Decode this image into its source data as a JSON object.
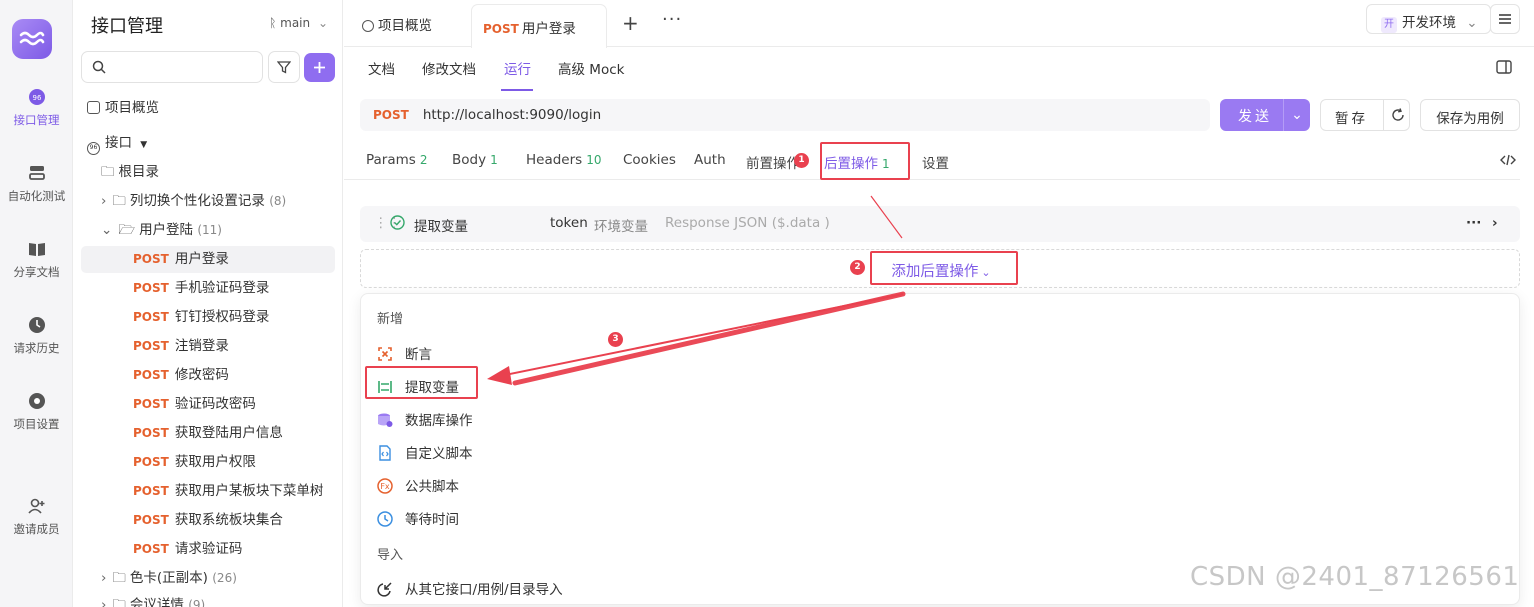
{
  "rail": {
    "items": [
      {
        "label": "接口管理",
        "icon": "api-icon"
      },
      {
        "label": "自动化测试",
        "icon": "automation-icon"
      },
      {
        "label": "分享文档",
        "icon": "book-icon"
      },
      {
        "label": "请求历史",
        "icon": "clock-icon"
      },
      {
        "label": "项目设置",
        "icon": "settings-icon"
      },
      {
        "label": "邀请成员",
        "icon": "invite-user-icon"
      }
    ]
  },
  "tree": {
    "title": "接口管理",
    "branch": "main",
    "search_placeholder": "",
    "overview": "项目概览",
    "api_root": "接口",
    "root_dir": "根目录",
    "folders": [
      {
        "name": "列切换个性化设置记录",
        "count": "(8)"
      },
      {
        "name": "用户登陆",
        "count": "(11)"
      },
      {
        "name": "色卡(正副本)",
        "count": "(26)"
      },
      {
        "name": "会议详情",
        "count": "(9)"
      }
    ],
    "method": "POST",
    "endpoints": [
      "用户登录",
      "手机验证码登录",
      "钉钉授权码登录",
      "注销登录",
      "修改密码",
      "验证码改密码",
      "获取登陆用户信息",
      "获取用户权限",
      "获取用户某板块下菜单树",
      "获取系统板块集合",
      "请求验证码"
    ]
  },
  "topbar": {
    "tab_overview": "项目概览",
    "tab_active_method": "POST",
    "tab_active_name": "用户登录",
    "env_badge": "开",
    "env_name": "开发环境"
  },
  "subtabs": [
    "文档",
    "修改文档",
    "运行",
    "高级 Mock"
  ],
  "request": {
    "method": "POST",
    "url": "http://localhost:9090/login",
    "send": "发送",
    "save": "暂存",
    "save_as": "保存为用例"
  },
  "reqtabs": [
    {
      "label": "Params",
      "count": "2"
    },
    {
      "label": "Body",
      "count": "1"
    },
    {
      "label": "Headers",
      "count": "10"
    },
    {
      "label": "Cookies",
      "count": ""
    },
    {
      "label": "Auth",
      "count": ""
    },
    {
      "label": "前置操作",
      "count": ""
    },
    {
      "label": "后置操作",
      "count": "1"
    },
    {
      "label": "设置",
      "count": ""
    }
  ],
  "extract_row": {
    "name": "提取变量",
    "var": "token",
    "scope": "环境变量",
    "source": "Response JSON ($.data )"
  },
  "add_post_action": "添加后置操作",
  "menu": {
    "new_header": "新增",
    "items": [
      "断言",
      "提取变量",
      "数据库操作",
      "自定义脚本",
      "公共脚本",
      "等待时间"
    ],
    "import_header": "导入",
    "import_item": "从其它接口/用例/目录导入"
  },
  "steps": [
    "1",
    "2",
    "3"
  ],
  "watermark": "CSDN @2401_87126561",
  "colors": {
    "accent": "#7d5ae6",
    "post": "#e5612e",
    "annotation": "#e9414f",
    "count": "#35a86b"
  }
}
